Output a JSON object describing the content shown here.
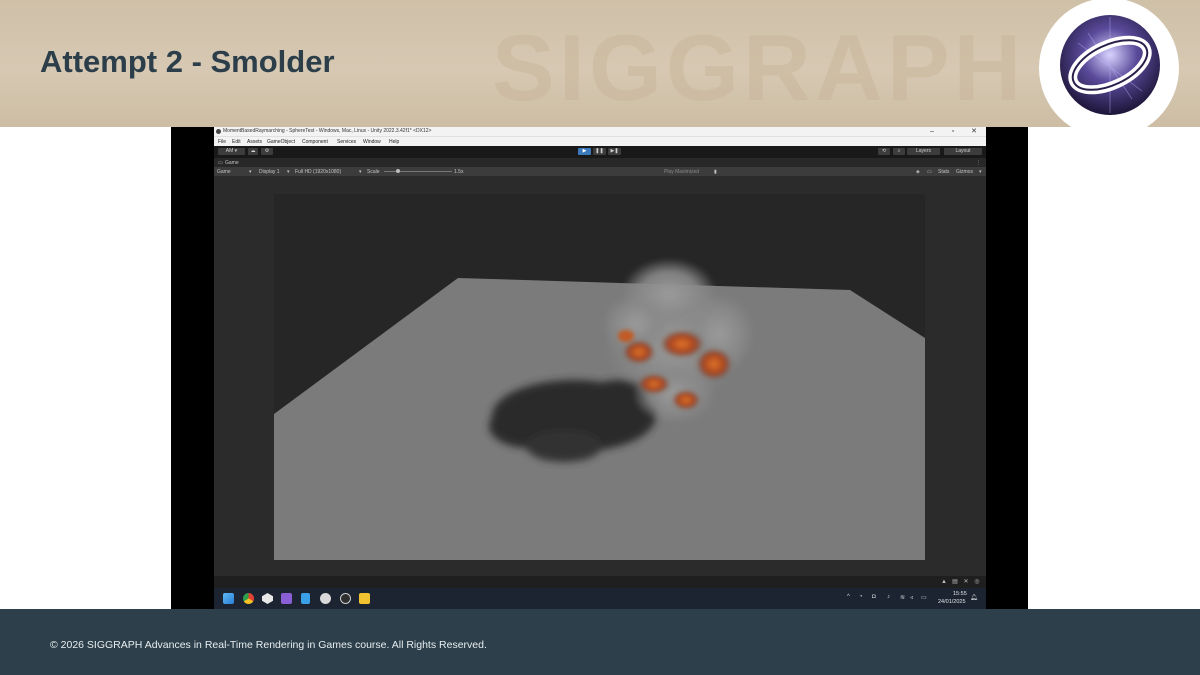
{
  "slide": {
    "title": "Attempt 2 - Smolder",
    "watermark": "SIGGRAPH",
    "copyright": "© 2026 SIGGRAPH Advances in Real-Time Rendering in Games course. All Rights Reserved."
  },
  "window": {
    "title": "MomentBasedRaymarching - SphereTest - Windows, Mac, Linux - Unity 2022.3.42f1* <DX12>",
    "controls": [
      "–",
      "▫",
      "✕"
    ]
  },
  "menu": [
    "File",
    "Edit",
    "Assets",
    "GameObject",
    "Component",
    "Services",
    "Window",
    "Help"
  ],
  "toolbar": {
    "account": "AM ▾",
    "cloud_icon": "cloud-icon",
    "history_icon": "history-icon",
    "search_icon": "search-icon",
    "layers": "Layers",
    "layout": "Layout"
  },
  "game_panel": {
    "tab_label": "Game",
    "view_mode": "Game",
    "display": "Display 1",
    "resolution": "Full HD (1920x1080)",
    "scale_label": "Scale",
    "scale_value": "1.5x",
    "play_mode": "Play Maximized",
    "stats": "Stats",
    "gizmos": "Gizmos"
  },
  "taskbar": {
    "time": "15:55",
    "date": "24/01/2025",
    "apps": [
      "windows-start-icon",
      "chrome-icon",
      "unity-icon",
      "visual-studio-icon",
      "notepad-icon",
      "unity-hub-icon",
      "obs-icon",
      "file-explorer-icon"
    ]
  },
  "colors": {
    "header_bg": "#d2c3ab",
    "title_text": "#2b3e4a",
    "footer_bg": "#2c3f4a",
    "play_accent": "#3a79bb"
  }
}
